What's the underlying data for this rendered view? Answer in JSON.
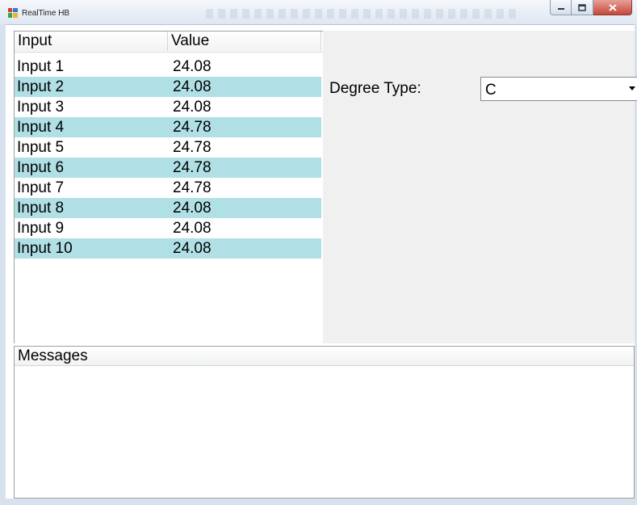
{
  "window": {
    "title": "RealTime HB",
    "controls": {
      "minimize_icon": "minimize-icon",
      "maximize_icon": "maximize-icon",
      "close_icon": "close-icon"
    }
  },
  "inputs_list": {
    "columns": [
      "Input",
      "Value"
    ],
    "rows": [
      {
        "input": "Input 1",
        "value": "24.08"
      },
      {
        "input": "Input 2",
        "value": "24.08"
      },
      {
        "input": "Input 3",
        "value": "24.08"
      },
      {
        "input": "Input 4",
        "value": "24.78"
      },
      {
        "input": "Input 5",
        "value": "24.78"
      },
      {
        "input": "Input 6",
        "value": "24.78"
      },
      {
        "input": "Input 7",
        "value": "24.78"
      },
      {
        "input": "Input 8",
        "value": "24.08"
      },
      {
        "input": "Input 9",
        "value": "24.08"
      },
      {
        "input": "Input 10",
        "value": "24.08"
      }
    ],
    "alt_row_color": "#b0e0e6"
  },
  "settings": {
    "degree_label": "Degree Type:",
    "degree_value": "C"
  },
  "messages": {
    "header": "Messages"
  }
}
